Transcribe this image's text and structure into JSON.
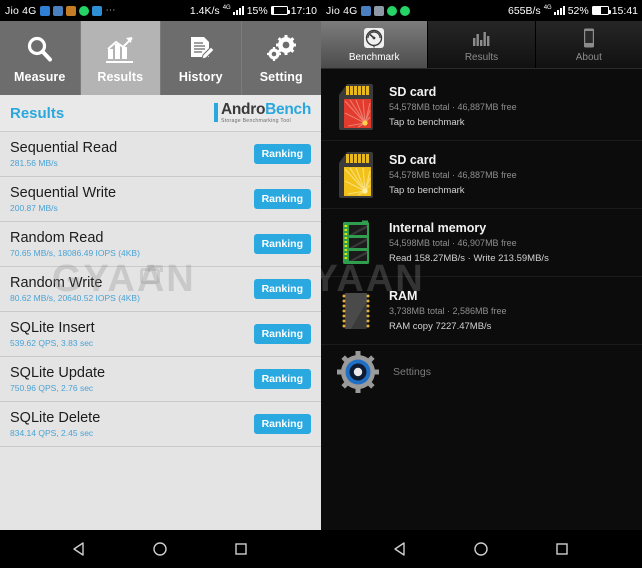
{
  "left_phone": {
    "status_bar": {
      "carrier": "Jio 4G",
      "app_icons": [
        "messenger-icon",
        "contacts-icon",
        "lock-icon",
        "whatsapp-icon",
        "bluetooth-icon"
      ],
      "overflow": "⋯",
      "network_speed": "1.4K/s",
      "network_type": "4G",
      "battery_percent": "15%",
      "clock": "17:10"
    },
    "tabs": [
      {
        "label": "Measure",
        "icon": "magnifier-icon",
        "active": false
      },
      {
        "label": "Results",
        "icon": "bar-chart-icon",
        "active": true
      },
      {
        "label": "History",
        "icon": "document-edit-icon",
        "active": false
      },
      {
        "label": "Setting",
        "icon": "gears-icon",
        "active": false
      }
    ],
    "header": {
      "title": "Results",
      "logo_primary": "Andro",
      "logo_secondary": "Bench",
      "logo_tagline": "Storage Benchmarking Tool"
    },
    "results": [
      {
        "name": "Sequential Read",
        "value": "281.56 MB/s",
        "button": "Ranking"
      },
      {
        "name": "Sequential Write",
        "value": "200.87 MB/s",
        "button": "Ranking"
      },
      {
        "name": "Random Read",
        "value": "70.65 MB/s, 18086.49 IOPS (4KB)",
        "button": "Ranking"
      },
      {
        "name": "Random Write",
        "value": "80.62 MB/s, 20640.52 IOPS (4KB)",
        "button": "Ranking"
      },
      {
        "name": "SQLite Insert",
        "value": "539.62 QPS, 3.83 sec",
        "button": "Ranking"
      },
      {
        "name": "SQLite Update",
        "value": "750.96 QPS, 2.76 sec",
        "button": "Ranking"
      },
      {
        "name": "SQLite Delete",
        "value": "834.14 QPS, 2.45 sec",
        "button": "Ranking"
      }
    ],
    "watermark": "GYAAN"
  },
  "right_phone": {
    "status_bar": {
      "carrier": "Jio 4G",
      "app_icons": [
        "contacts-icon",
        "gallery-icon",
        "whatsapp-icon",
        "whatsapp-icon"
      ],
      "network_speed": "655B/s",
      "network_type": "4G",
      "battery_percent": "52%",
      "clock": "15:41"
    },
    "tabs": [
      {
        "label": "Benchmark",
        "icon": "speedometer-icon",
        "active": true
      },
      {
        "label": "Results",
        "icon": "bar-chart-icon",
        "active": false
      },
      {
        "label": "About",
        "icon": "phone-icon",
        "active": false
      }
    ],
    "devices": [
      {
        "title": "SD card",
        "meta": "54,578MB total · 46,887MB free",
        "action": "Tap to benchmark",
        "icon": "sd-card-red-icon"
      },
      {
        "title": "SD card",
        "meta": "54,578MB total · 46,887MB free",
        "action": "Tap to benchmark",
        "icon": "sd-card-yellow-icon"
      },
      {
        "title": "Internal memory",
        "meta": "54,598MB total · 46,907MB free",
        "action": "Read 158.27MB/s · Write 213.59MB/s",
        "icon": "memory-stick-icon"
      },
      {
        "title": "RAM",
        "meta": "3,738MB total · 2,586MB free",
        "action": "RAM copy 7227.47MB/s",
        "icon": "ram-chip-icon"
      }
    ],
    "settings": {
      "label": "Settings",
      "icon": "gear-blue-icon"
    },
    "watermark": "GYAAN"
  },
  "nav_bar": {
    "back": "back-triangle-icon",
    "home": "home-circle-icon",
    "recents": "recents-square-icon"
  },
  "colors": {
    "accent_blue": "#29a9e0",
    "tab_active_light": "#b4b4b4",
    "tab_bg_light": "#6d6d6d",
    "list_bg_light": "#e4e4e4",
    "dark_bg": "#0c0c0c"
  }
}
